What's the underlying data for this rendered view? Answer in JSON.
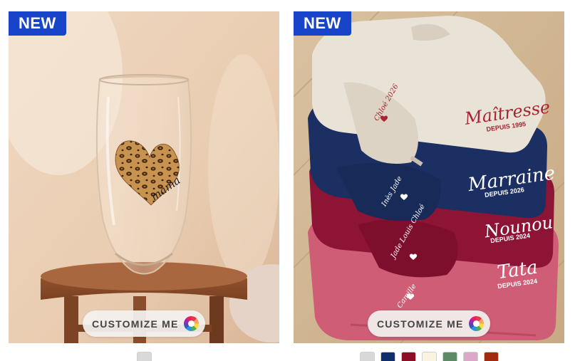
{
  "products": [
    {
      "badge": "NEW",
      "image_alt": "Personalized leopard heart mama glass vase on wooden stool",
      "customize_label": "CUSTOMIZE ME",
      "print_text": "mama",
      "swatches": [
        {
          "color": "#d9d9d9"
        }
      ]
    },
    {
      "badge": "NEW",
      "image_alt": "Stack of personalized embroidered sweatshirts",
      "customize_label": "CUSTOMIZE ME",
      "embroidery": [
        {
          "name": "Maîtresse",
          "since": "DEPUIS 1995",
          "sleeve": "Chloé 2026"
        },
        {
          "name": "Marraine",
          "since": "DEPUIS 2026",
          "sleeve": "Inès Jade"
        },
        {
          "name": "Nounou",
          "since": "DEPUIS 2024",
          "sleeve": "Jade Louis Chloé"
        },
        {
          "name": "Tata",
          "since": "DEPUIS 2024",
          "sleeve": "Camille"
        }
      ],
      "swatches": [
        {
          "color": "#d8d8d8"
        },
        {
          "color": "#0f2f6b"
        },
        {
          "color": "#8c0f26"
        },
        {
          "color": "#fbf3e2"
        },
        {
          "color": "#5e8a66"
        },
        {
          "color": "#dca8c8"
        },
        {
          "color": "#a32a0e"
        }
      ]
    }
  ],
  "colors": {
    "badge_bg": "#1744c8",
    "badge_text": "#ffffff"
  }
}
